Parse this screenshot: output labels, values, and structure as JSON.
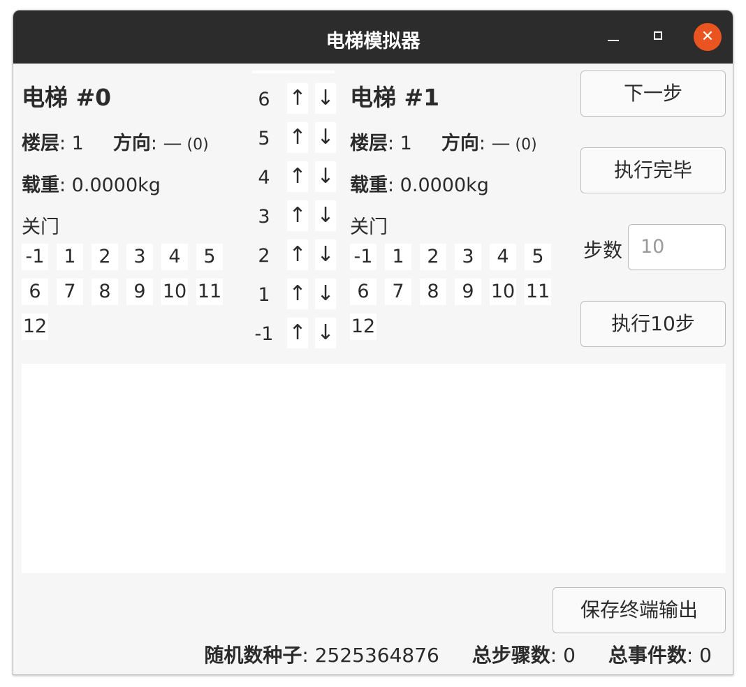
{
  "window": {
    "title": "电梯模拟器",
    "close_glyph": "✕"
  },
  "elevators": [
    {
      "title": "电梯 #0",
      "floor_label": "楼层",
      "floor_value": ": 1",
      "direction_label": "方向",
      "direction_value": ": —",
      "direction_code": " (0)",
      "load_label": "载重",
      "load_value": ": 0.0000kg",
      "door_status": "关门",
      "floor_buttons": [
        "-1",
        "1",
        "2",
        "3",
        "4",
        "5",
        "6",
        "7",
        "8",
        "9",
        "10",
        "11",
        "12"
      ]
    },
    {
      "title": "电梯 #1",
      "floor_label": "楼层",
      "floor_value": ": 1",
      "direction_label": "方向",
      "direction_value": ": —",
      "direction_code": " (0)",
      "load_label": "载重",
      "load_value": ": 0.0000kg",
      "door_status": "关门",
      "floor_buttons": [
        "-1",
        "1",
        "2",
        "3",
        "4",
        "5",
        "6",
        "7",
        "8",
        "9",
        "10",
        "11",
        "12"
      ]
    }
  ],
  "call_panel": {
    "up_glyph": "↑",
    "down_glyph": "↓",
    "floors": [
      "6",
      "5",
      "4",
      "3",
      "2",
      "1",
      "-1"
    ]
  },
  "controls": {
    "next_step": "下一步",
    "run_to_end": "执行完毕",
    "steps_label": "步数",
    "steps_placeholder": "10",
    "run_n_steps": "执行10步",
    "save_output": "保存终端输出"
  },
  "status": {
    "seed_label": "随机数种子",
    "seed_value": ": 2525364876",
    "steps_label": "总步骤数",
    "steps_value": ": 0",
    "events_label": "总事件数",
    "events_value": ": 0"
  },
  "colors": {
    "titlebar": "#2c2c2c",
    "close_button": "#e95420",
    "window_bg": "#f6f6f6"
  }
}
